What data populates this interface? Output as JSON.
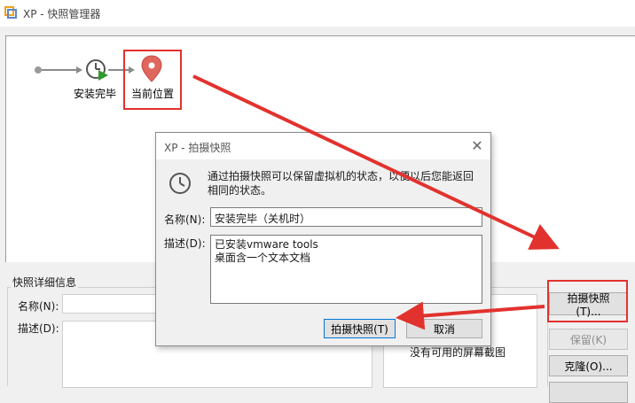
{
  "window": {
    "title": "XP - 快照管理器"
  },
  "tree": {
    "nodes": [
      {
        "label": "安装完毕"
      },
      {
        "label": "当前位置"
      }
    ]
  },
  "details": {
    "group_title": "快照详细信息",
    "name_label": "名称(N):",
    "name_value": "",
    "desc_label": "描述(D):",
    "desc_value": "",
    "screenshot_placeholder": "没有可用的屏幕截图"
  },
  "buttons": {
    "take_snapshot": "拍摄快照(T)...",
    "keep": "保留(K)",
    "clone": "克隆(O)..."
  },
  "dialog": {
    "title": "XP - 拍摄快照",
    "info_text": "通过拍摄快照可以保留虚拟机的状态，以便以后您能返回相同的状态。",
    "name_label": "名称(N):",
    "name_value": "安装完毕（关机时）",
    "desc_label": "描述(D):",
    "desc_value": "已安装vmware tools\n桌面含一个文本文档",
    "ok_button": "拍摄快照(T)",
    "cancel_button": "取消"
  },
  "colors": {
    "highlight": "#e2322e",
    "pin": "#e0675e",
    "play_arrow": "#2e9a2e"
  }
}
